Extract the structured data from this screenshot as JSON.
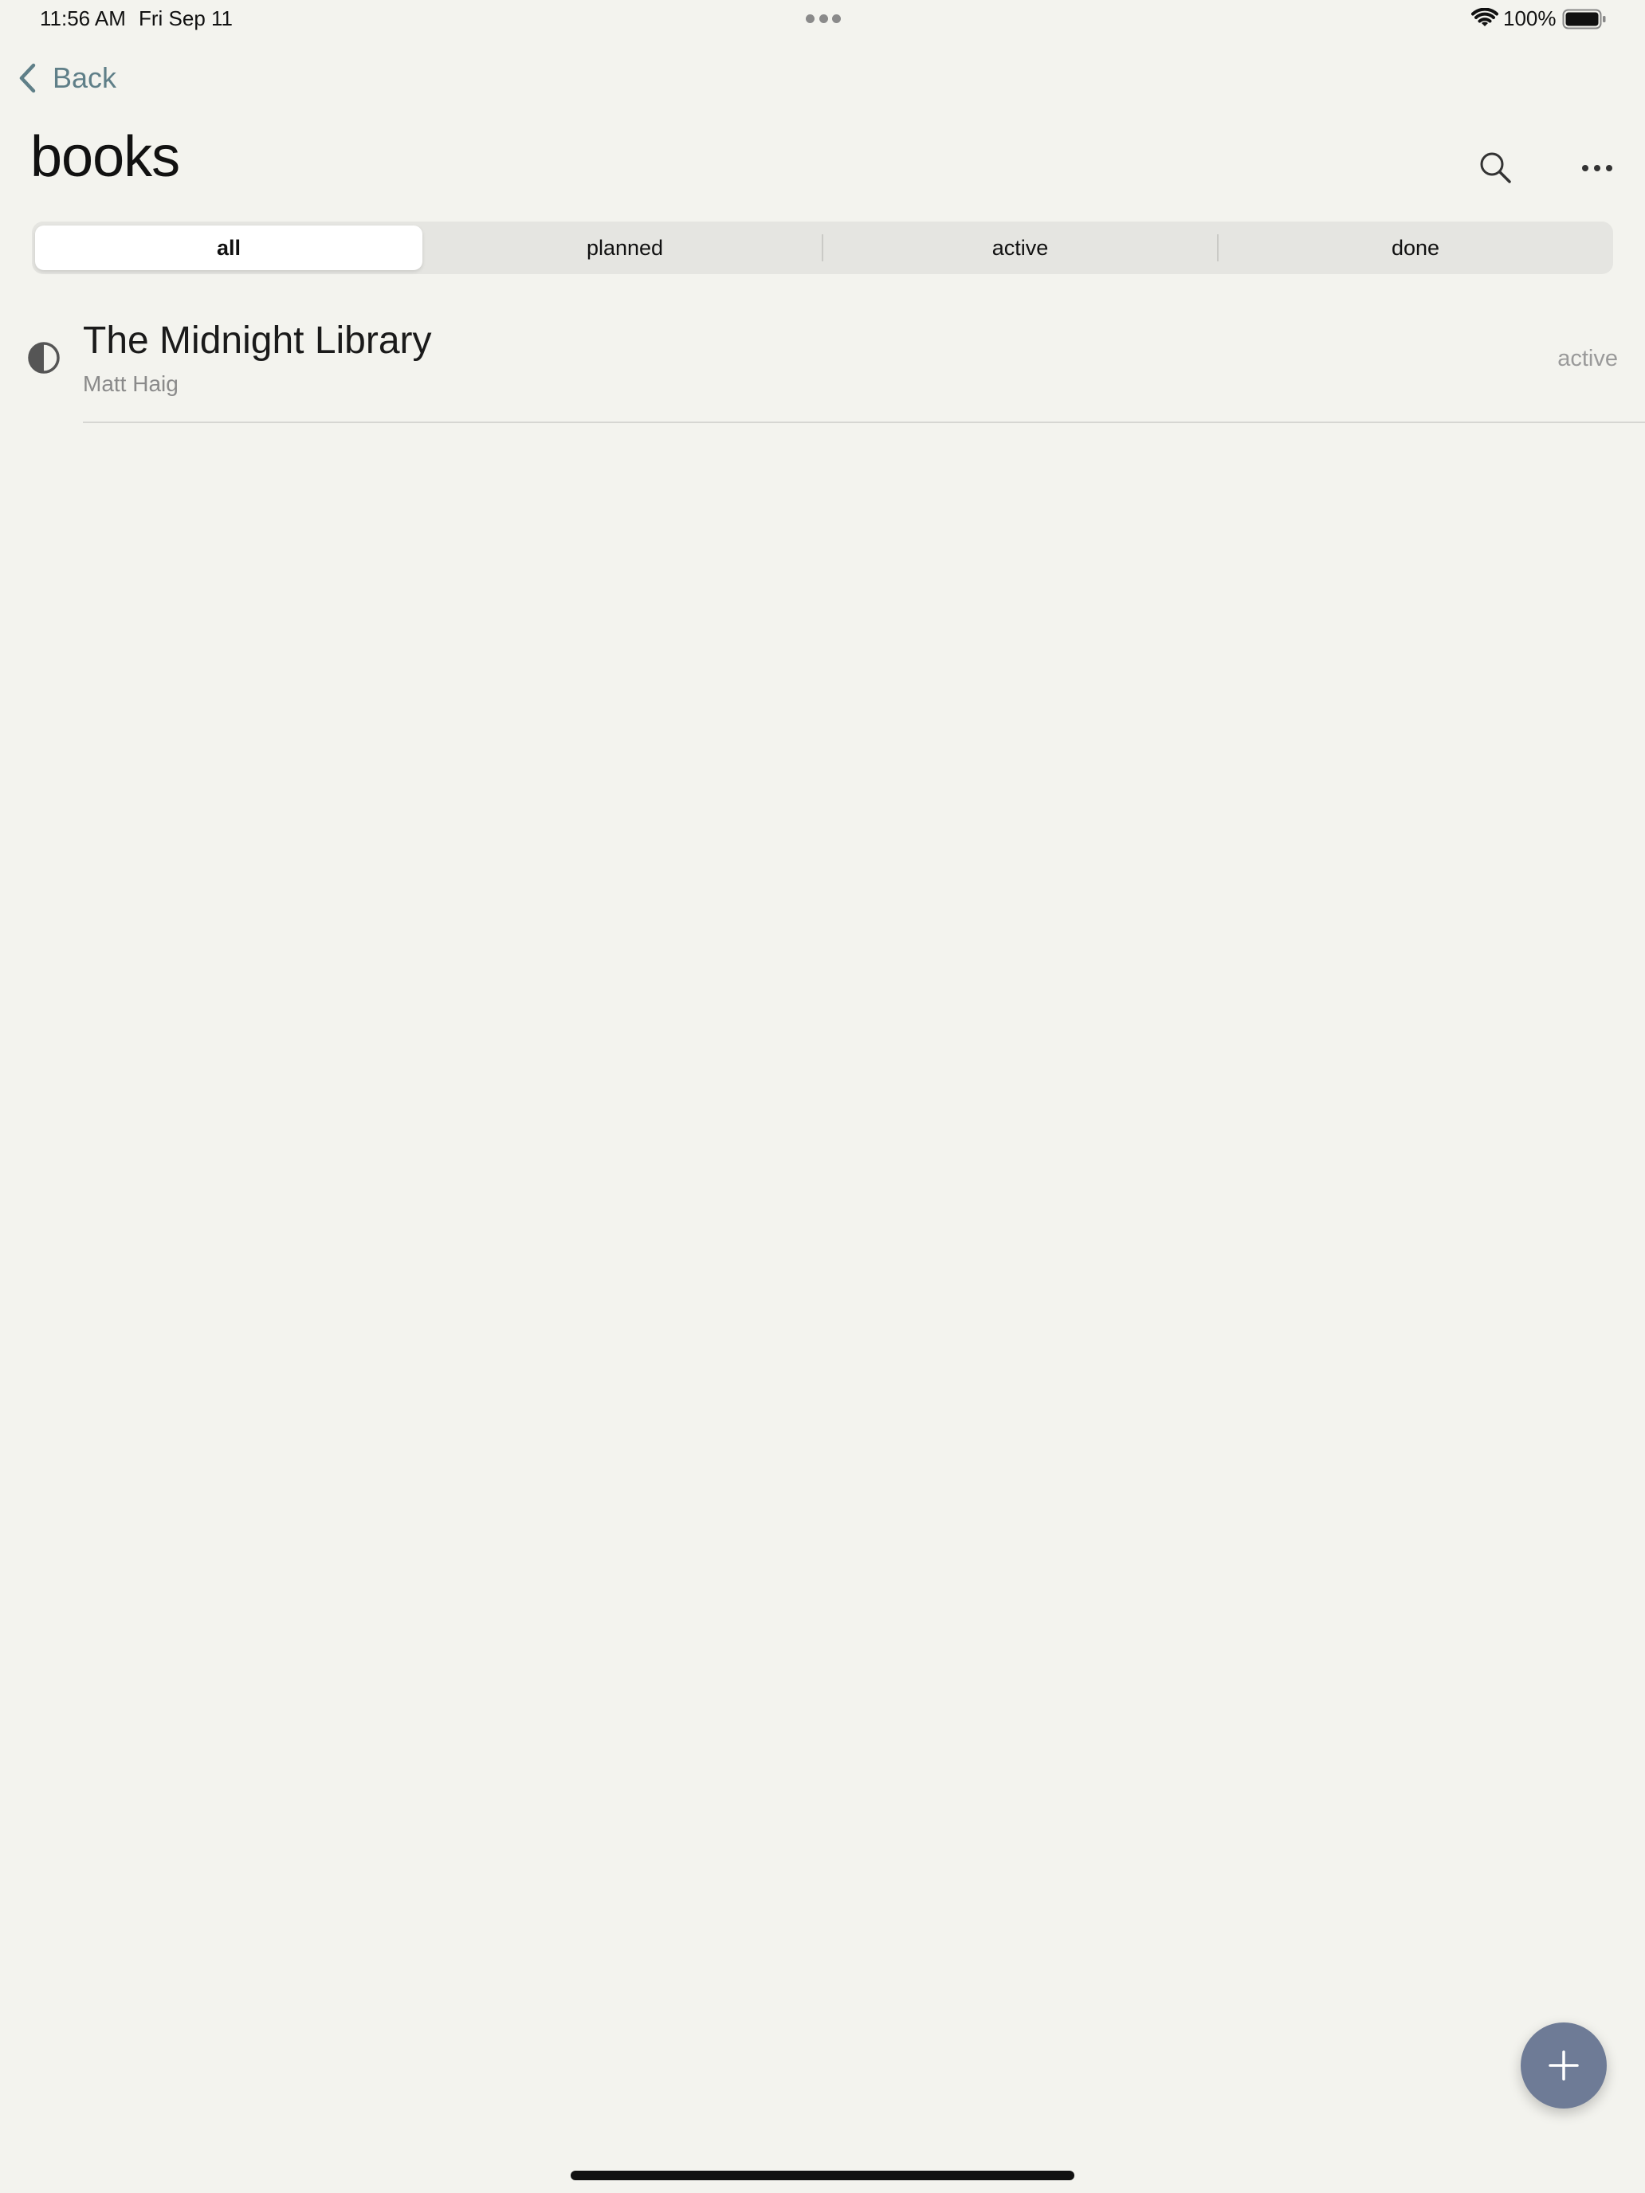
{
  "status_bar": {
    "time": "11:56 AM",
    "date": "Fri Sep 11",
    "battery": "100%"
  },
  "nav": {
    "back_label": "Back"
  },
  "page": {
    "title": "books"
  },
  "filters": {
    "selected": "all",
    "tabs": [
      {
        "label": "all"
      },
      {
        "label": "planned"
      },
      {
        "label": "active"
      },
      {
        "label": "done"
      }
    ]
  },
  "books": [
    {
      "title": "The Midnight Library",
      "author": "Matt Haig",
      "status": "active",
      "status_icon": "half-circle-icon"
    }
  ],
  "colors": {
    "background": "#f3f3ee",
    "accent": "#5f7f88",
    "fab": "#6e7b96"
  }
}
